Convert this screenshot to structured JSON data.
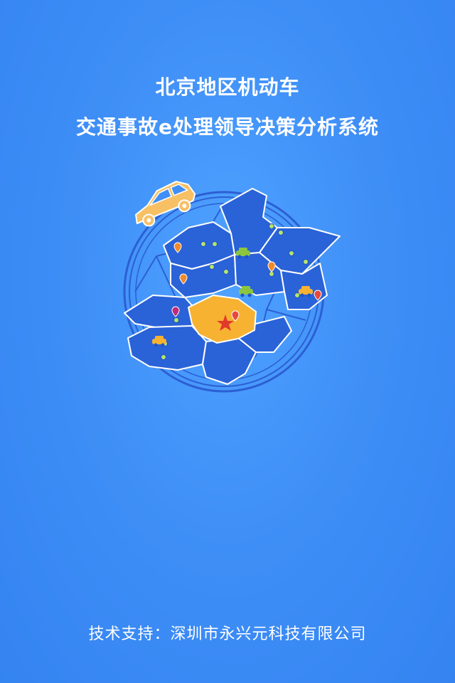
{
  "header": {
    "title_line1": "北京地区机动车",
    "title_line2": "交通事故e处理领导决策分析系统"
  },
  "footer": {
    "tech_support": "技术支持：深圳市永兴元科技有限公司"
  },
  "illustration": {
    "icons": [
      "car-icon",
      "map-pin-icon",
      "star-icon",
      "wheel-emblem"
    ],
    "colors": {
      "background": "#3f8ff7",
      "map_region": "#2a62d8",
      "highlight_region": "#f7b232",
      "car": "#f7c065",
      "pin": "#f08a2a",
      "dot": "#b6e36a",
      "star": "#e23a2a"
    }
  }
}
